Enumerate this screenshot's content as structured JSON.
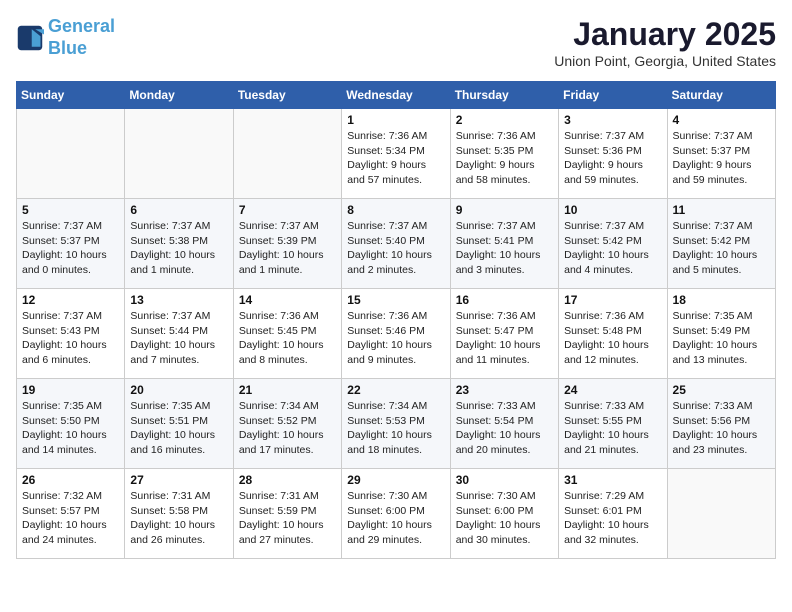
{
  "logo": {
    "line1": "General",
    "line2": "Blue"
  },
  "title": "January 2025",
  "subtitle": "Union Point, Georgia, United States",
  "headers": [
    "Sunday",
    "Monday",
    "Tuesday",
    "Wednesday",
    "Thursday",
    "Friday",
    "Saturday"
  ],
  "weeks": [
    [
      {
        "day": "",
        "info": ""
      },
      {
        "day": "",
        "info": ""
      },
      {
        "day": "",
        "info": ""
      },
      {
        "day": "1",
        "info": "Sunrise: 7:36 AM\nSunset: 5:34 PM\nDaylight: 9 hours\nand 57 minutes."
      },
      {
        "day": "2",
        "info": "Sunrise: 7:36 AM\nSunset: 5:35 PM\nDaylight: 9 hours\nand 58 minutes."
      },
      {
        "day": "3",
        "info": "Sunrise: 7:37 AM\nSunset: 5:36 PM\nDaylight: 9 hours\nand 59 minutes."
      },
      {
        "day": "4",
        "info": "Sunrise: 7:37 AM\nSunset: 5:37 PM\nDaylight: 9 hours\nand 59 minutes."
      }
    ],
    [
      {
        "day": "5",
        "info": "Sunrise: 7:37 AM\nSunset: 5:37 PM\nDaylight: 10 hours\nand 0 minutes."
      },
      {
        "day": "6",
        "info": "Sunrise: 7:37 AM\nSunset: 5:38 PM\nDaylight: 10 hours\nand 1 minute."
      },
      {
        "day": "7",
        "info": "Sunrise: 7:37 AM\nSunset: 5:39 PM\nDaylight: 10 hours\nand 1 minute."
      },
      {
        "day": "8",
        "info": "Sunrise: 7:37 AM\nSunset: 5:40 PM\nDaylight: 10 hours\nand 2 minutes."
      },
      {
        "day": "9",
        "info": "Sunrise: 7:37 AM\nSunset: 5:41 PM\nDaylight: 10 hours\nand 3 minutes."
      },
      {
        "day": "10",
        "info": "Sunrise: 7:37 AM\nSunset: 5:42 PM\nDaylight: 10 hours\nand 4 minutes."
      },
      {
        "day": "11",
        "info": "Sunrise: 7:37 AM\nSunset: 5:42 PM\nDaylight: 10 hours\nand 5 minutes."
      }
    ],
    [
      {
        "day": "12",
        "info": "Sunrise: 7:37 AM\nSunset: 5:43 PM\nDaylight: 10 hours\nand 6 minutes."
      },
      {
        "day": "13",
        "info": "Sunrise: 7:37 AM\nSunset: 5:44 PM\nDaylight: 10 hours\nand 7 minutes."
      },
      {
        "day": "14",
        "info": "Sunrise: 7:36 AM\nSunset: 5:45 PM\nDaylight: 10 hours\nand 8 minutes."
      },
      {
        "day": "15",
        "info": "Sunrise: 7:36 AM\nSunset: 5:46 PM\nDaylight: 10 hours\nand 9 minutes."
      },
      {
        "day": "16",
        "info": "Sunrise: 7:36 AM\nSunset: 5:47 PM\nDaylight: 10 hours\nand 11 minutes."
      },
      {
        "day": "17",
        "info": "Sunrise: 7:36 AM\nSunset: 5:48 PM\nDaylight: 10 hours\nand 12 minutes."
      },
      {
        "day": "18",
        "info": "Sunrise: 7:35 AM\nSunset: 5:49 PM\nDaylight: 10 hours\nand 13 minutes."
      }
    ],
    [
      {
        "day": "19",
        "info": "Sunrise: 7:35 AM\nSunset: 5:50 PM\nDaylight: 10 hours\nand 14 minutes."
      },
      {
        "day": "20",
        "info": "Sunrise: 7:35 AM\nSunset: 5:51 PM\nDaylight: 10 hours\nand 16 minutes."
      },
      {
        "day": "21",
        "info": "Sunrise: 7:34 AM\nSunset: 5:52 PM\nDaylight: 10 hours\nand 17 minutes."
      },
      {
        "day": "22",
        "info": "Sunrise: 7:34 AM\nSunset: 5:53 PM\nDaylight: 10 hours\nand 18 minutes."
      },
      {
        "day": "23",
        "info": "Sunrise: 7:33 AM\nSunset: 5:54 PM\nDaylight: 10 hours\nand 20 minutes."
      },
      {
        "day": "24",
        "info": "Sunrise: 7:33 AM\nSunset: 5:55 PM\nDaylight: 10 hours\nand 21 minutes."
      },
      {
        "day": "25",
        "info": "Sunrise: 7:33 AM\nSunset: 5:56 PM\nDaylight: 10 hours\nand 23 minutes."
      }
    ],
    [
      {
        "day": "26",
        "info": "Sunrise: 7:32 AM\nSunset: 5:57 PM\nDaylight: 10 hours\nand 24 minutes."
      },
      {
        "day": "27",
        "info": "Sunrise: 7:31 AM\nSunset: 5:58 PM\nDaylight: 10 hours\nand 26 minutes."
      },
      {
        "day": "28",
        "info": "Sunrise: 7:31 AM\nSunset: 5:59 PM\nDaylight: 10 hours\nand 27 minutes."
      },
      {
        "day": "29",
        "info": "Sunrise: 7:30 AM\nSunset: 6:00 PM\nDaylight: 10 hours\nand 29 minutes."
      },
      {
        "day": "30",
        "info": "Sunrise: 7:30 AM\nSunset: 6:00 PM\nDaylight: 10 hours\nand 30 minutes."
      },
      {
        "day": "31",
        "info": "Sunrise: 7:29 AM\nSunset: 6:01 PM\nDaylight: 10 hours\nand 32 minutes."
      },
      {
        "day": "",
        "info": ""
      }
    ]
  ]
}
